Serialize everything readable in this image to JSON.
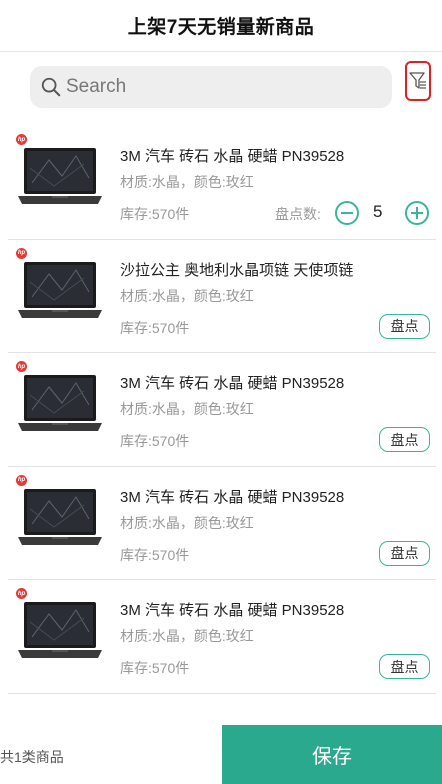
{
  "header": {
    "title": "上架7天无销量新商品"
  },
  "search": {
    "placeholder": "Search",
    "value": ""
  },
  "icons": {
    "search": "search-icon",
    "filter": "filter-icon",
    "brand_badge": "hp-logo-icon"
  },
  "colors": {
    "accent": "#2aa98f",
    "filter_border": "#e02020"
  },
  "products": [
    {
      "name": "3M 汽车 砖石 水晶 硬蜡 PN39528",
      "attrs": "材质:水晶，颜色:玫红",
      "stock": "库存:570件",
      "count_label": "盘点数:",
      "count_value": "5"
    },
    {
      "name": "沙拉公主 奥地利水晶项链 天使项链",
      "attrs": "材质:水晶，颜色:玫红",
      "stock": "库存:570件",
      "action": "盘点"
    },
    {
      "name": "3M 汽车 砖石 水晶 硬蜡 PN39528",
      "attrs": "材质:水晶，颜色:玫红",
      "stock": "库存:570件",
      "action": "盘点"
    },
    {
      "name": "3M 汽车 砖石 水晶 硬蜡 PN39528",
      "attrs": "材质:水晶，颜色:玫红",
      "stock": "库存:570件",
      "action": "盘点"
    },
    {
      "name": "3M 汽车 砖石 水晶 硬蜡 PN39528",
      "attrs": "材质:水晶，颜色:玫红",
      "stock": "库存:570件",
      "action": "盘点"
    }
  ],
  "footer": {
    "summary": "共1类商品",
    "save_label": "保存"
  }
}
